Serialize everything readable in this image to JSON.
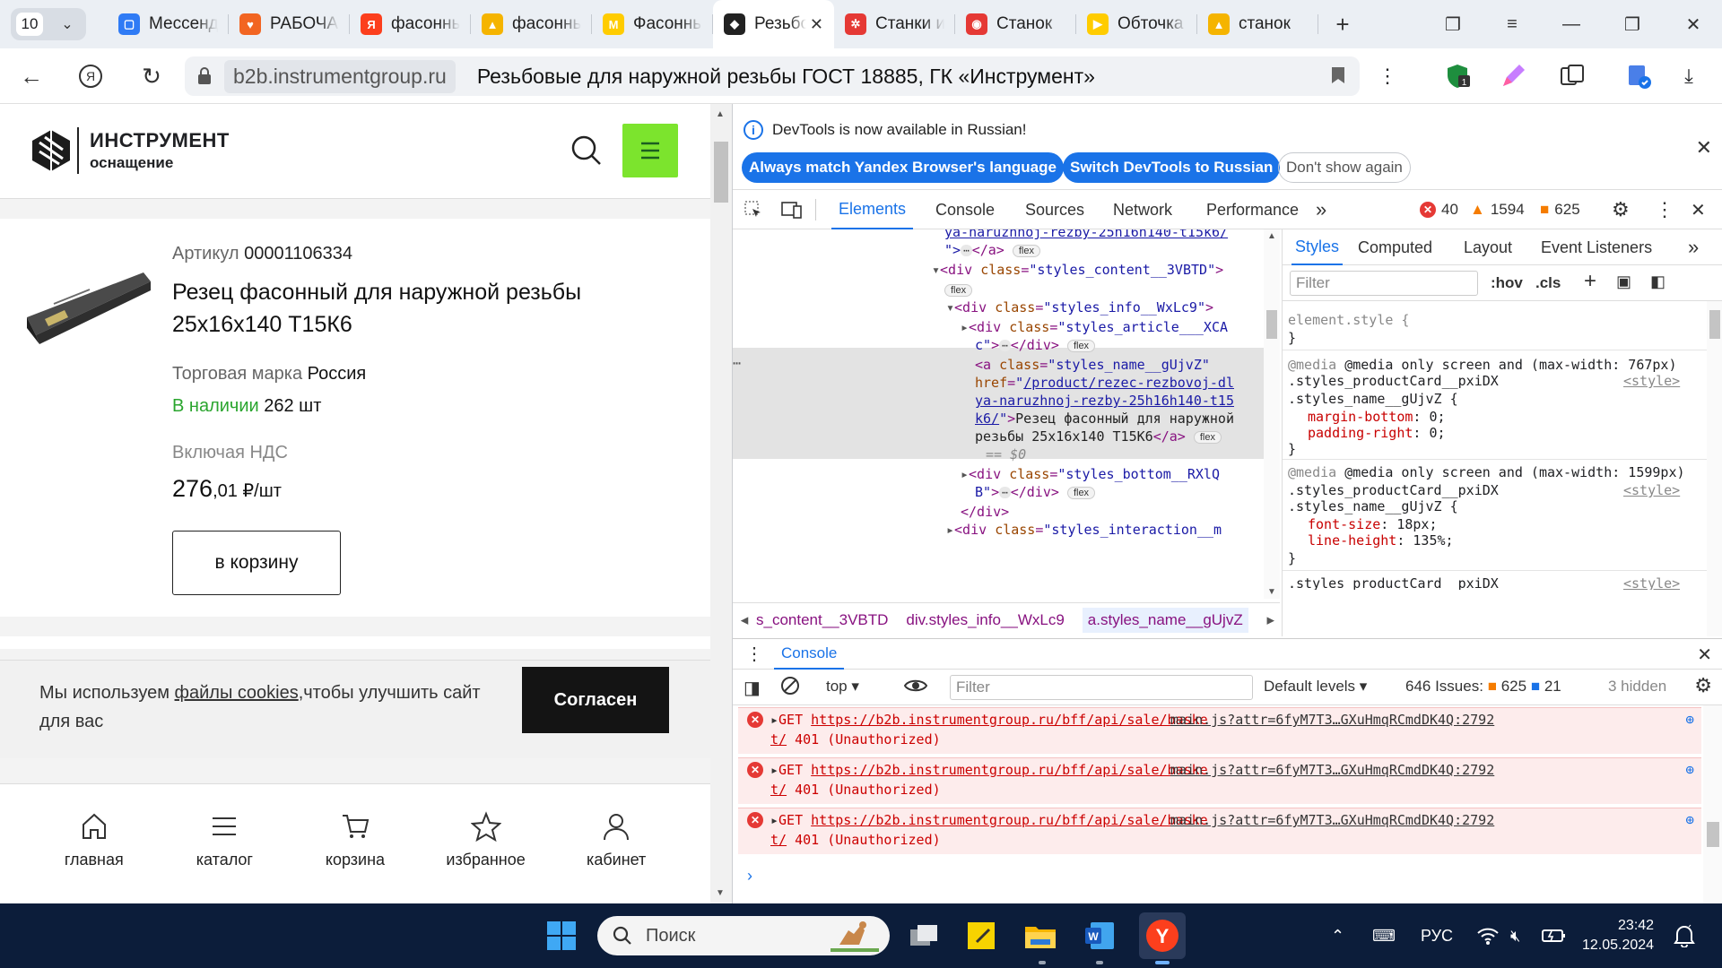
{
  "browser": {
    "tab_count": "10",
    "tabs": [
      {
        "title": "Мессенджер",
        "color": "#2f7bf5",
        "glyph": "▢"
      },
      {
        "title": "РАБОЧАЯ",
        "color": "#f26522",
        "glyph": "♥"
      },
      {
        "title": "фасонный",
        "color": "#fc3f1d",
        "glyph": "Я"
      },
      {
        "title": "фасонный",
        "color": "#f5b400",
        "glyph": "▲"
      },
      {
        "title": "Фасонный",
        "color": "#ffcc00",
        "glyph": "M"
      },
      {
        "title": "Резьбовые",
        "color": "#222222",
        "glyph": "◆",
        "active": true
      },
      {
        "title": "Станки и",
        "color": "#e53935",
        "glyph": "✲"
      },
      {
        "title": "Станок",
        "color": "#e53935",
        "glyph": "◉"
      },
      {
        "title": "Обточка",
        "color": "#ffcc00",
        "glyph": "▶"
      },
      {
        "title": "станок",
        "color": "#f5b400",
        "glyph": "▲"
      }
    ],
    "address": {
      "domain": "b2b.instrumentgroup.ru",
      "page_title": "Резьбовые для наружной резьбы ГОСТ 18885, ГК «Инструмент»"
    }
  },
  "site": {
    "logo": {
      "line1": "ИНСТРУМЕНТ",
      "line2": "оснащение"
    },
    "product": {
      "article_label": "Артикул",
      "article": "00001106334",
      "name": "Резец фасонный для наружной резьбы 25х16х140 Т15К6",
      "brand_label": "Торговая марка",
      "brand": "Россия",
      "stock_label": "В наличии",
      "stock_qty": "262 шт",
      "vat_label": "Включая НДС",
      "price_main": "276",
      "price_fraction": ",01 ₽/шт",
      "cart_button": "в корзину"
    },
    "cookie": {
      "text_before": "Мы используем ",
      "link": "файлы cookies",
      "text_after": ",чтобы улучшить сайт для вас",
      "agree": "Согласен"
    },
    "bottom_nav": [
      {
        "label": "главная",
        "icon": "home-icon"
      },
      {
        "label": "каталог",
        "icon": "menu-lines-icon"
      },
      {
        "label": "корзина",
        "icon": "cart-icon"
      },
      {
        "label": "избранное",
        "icon": "star-icon"
      },
      {
        "label": "кабинет",
        "icon": "user-icon"
      }
    ]
  },
  "devtools": {
    "info_message": "DevTools is now available in Russian!",
    "info_buttons": [
      "Always match Yandex Browser's language",
      "Switch DevTools to Russian",
      "Don't show again"
    ],
    "tabs": [
      "Elements",
      "Console",
      "Sources",
      "Network",
      "Performance"
    ],
    "errors": "40",
    "warnings": "1594",
    "issues": "625",
    "elements": {
      "line0": "ya-naruzhnoj-rezby-25h16h140-t15k6/",
      "line1_tail": "\">",
      "line1_close": "</a>",
      "content_div": "styles_content__3VBTD",
      "info_div": "styles_info__WxLc9",
      "article_div_a": "styles_article___XCA",
      "article_div_b": "c",
      "a_class": "styles_name__gUjvZ",
      "href_a": "/product/rezec-rezbovoj-dl",
      "href_b": "ya-naruzhnoj-rezby-25h16h140-t15",
      "href_c": "k6/",
      "a_text_a": "Резец фасонный для наружной",
      "a_text_b": "резьбы 25х16х140 Т15К6",
      "eq": "== $0",
      "bottom_div_a": "styles_bottom__RXlQ",
      "bottom_div_b": "B",
      "interaction_div": "styles_interaction__m",
      "flex": "flex"
    },
    "breadcrumbs": [
      "s_content__3VBTD",
      "div.styles_info__WxLc9",
      "a.styles_name__gUjvZ"
    ],
    "styles_tabs": [
      "Styles",
      "Computed",
      "Layout",
      "Event Listeners"
    ],
    "styles_filter": "Filter",
    "hov": ":hov",
    "cls": ".cls",
    "styles": {
      "element_style": "element.style {",
      "close": "}",
      "media1": "@media only screen and (max-width: 767px)",
      "sel1a": ".styles_productCard__pxiDX",
      "sel1b": ".styles_name__gUjvZ {",
      "src": "<style>",
      "p1": "margin-bottom",
      "v1": "0;",
      "p2": "padding-right",
      "v2": "0;",
      "media2": "@media only screen and (max-width: 1599px)",
      "sel2a": ".styles_productCard__pxiDX",
      "sel2b": ".styles_name__gUjvZ {",
      "p3": "font-size",
      "v3": "18px;",
      "p4": "line-height",
      "v4": "135%;",
      "sel3": ".styles_productCard__pxiDX"
    },
    "console": {
      "title": "Console",
      "context": "top",
      "filter": "Filter",
      "levels": "Default levels",
      "issues_label": "646 Issues:",
      "issues_warn": "625",
      "issues_info": "21",
      "hidden": "3 hidden",
      "entries": [
        {
          "method": "GET",
          "url_a": "https://b2b.instrumentgroup.ru/bff/api/sale/baske",
          "url_b": "t/",
          "status": "401 (Unauthorized)",
          "source": "main.js?attr=6fyM7T3…GXuHmqRCmdDK4Q:2792"
        },
        {
          "method": "GET",
          "url_a": "https://b2b.instrumentgroup.ru/bff/api/sale/baske",
          "url_b": "t/",
          "status": "401 (Unauthorized)",
          "source": "main.js?attr=6fyM7T3…GXuHmqRCmdDK4Q:2792"
        },
        {
          "method": "GET",
          "url_a": "https://b2b.instrumentgroup.ru/bff/api/sale/baske",
          "url_b": "t/",
          "status": "401 (Unauthorized)",
          "source": "main.js?attr=6fyM7T3…GXuHmqRCmdDK4Q:2792"
        }
      ]
    }
  },
  "taskbar": {
    "search": "Поиск",
    "lang": "РУС",
    "time": "23:42",
    "date": "12.05.2024"
  }
}
